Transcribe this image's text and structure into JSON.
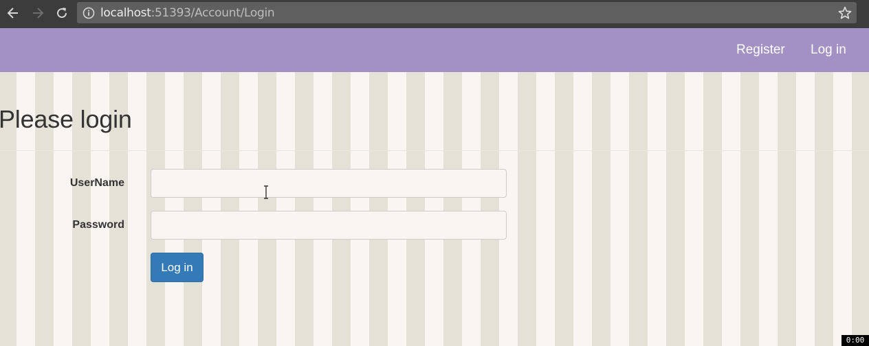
{
  "browser": {
    "url_host": "localhost",
    "url_rest": ":51393/Account/Login",
    "icons": [
      "back-arrow-icon",
      "forward-arrow-icon",
      "reload-icon",
      "info-icon",
      "star-icon"
    ]
  },
  "navbar": {
    "register_label": "Register",
    "login_label": "Log in",
    "background": "#a391c4"
  },
  "page": {
    "title": "Please login"
  },
  "form": {
    "username_label": "UserName",
    "username_value": "",
    "password_label": "Password",
    "password_value": "",
    "submit_label": "Log in",
    "submit_color": "#337ab7"
  },
  "overlay": {
    "timer": "0:00"
  }
}
